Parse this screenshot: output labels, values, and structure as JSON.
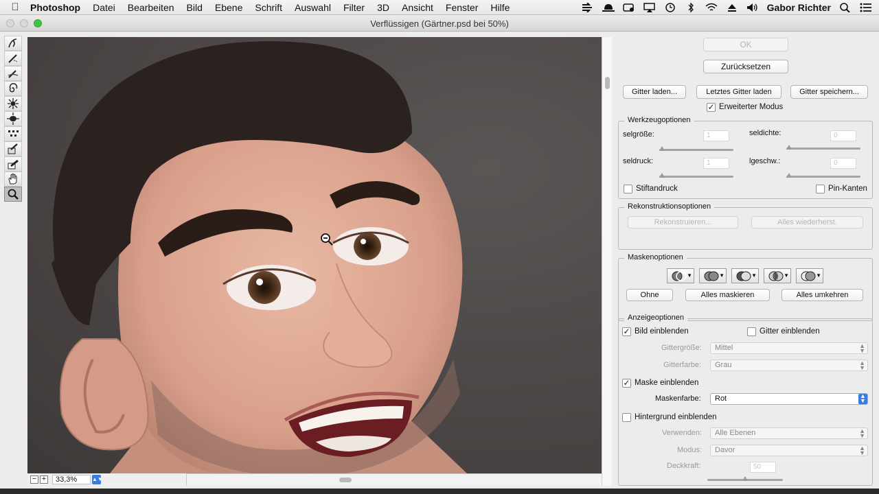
{
  "menubar": {
    "app_name": "Photoshop",
    "items": [
      "Datei",
      "Bearbeiten",
      "Bild",
      "Ebene",
      "Schrift",
      "Auswahl",
      "Filter",
      "3D",
      "Ansicht",
      "Fenster",
      "Hilfe"
    ],
    "user": "Gabor Richter"
  },
  "window": {
    "title": "Verflüssigen (Gärtner.psd bei 50%)"
  },
  "canvas": {
    "zoom": "33,3%"
  },
  "panel": {
    "ok_label": "OK",
    "reset_label": "Zurücksetzen",
    "load_mesh": "Gitter laden...",
    "load_last_mesh": "Letztes Gitter laden",
    "save_mesh": "Gitter speichern...",
    "advanced_mode": "Erweiterter Modus",
    "tool_options": {
      "title": "Werkzeugoptionen",
      "brush_size_label": "selgröße:",
      "brush_size_value": "1",
      "brush_density_label": "seldichte:",
      "brush_density_value": "0",
      "brush_pressure_label": "seldruck:",
      "brush_pressure_value": "1",
      "brush_rate_label": "lgeschw.:",
      "brush_rate_value": "0",
      "stylus_pressure": "Stiftandruck",
      "pin_edges": "Pin-Kanten"
    },
    "reconstruct_options": {
      "title": "Rekonstruktionsoptionen",
      "reconstruct": "Rekonstruieren...",
      "restore_all": "Alles wiederherst."
    },
    "mask_options": {
      "title": "Maskenoptionen",
      "none": "Ohne",
      "mask_all": "Alles maskieren",
      "invert_all": "Alles umkehren"
    },
    "view_options": {
      "title": "Anzeigeoptionen",
      "show_image": "Bild einblenden",
      "show_mesh": "Gitter einblenden",
      "mesh_size_label": "Gittergröße:",
      "mesh_size_value": "Mittel",
      "mesh_color_label": "Gitterfarbe:",
      "mesh_color_value": "Grau",
      "show_mask": "Maske einblenden",
      "mask_color_label": "Maskenfarbe:",
      "mask_color_value": "Rot",
      "show_backdrop": "Hintergrund einblenden",
      "use_label": "Verwenden:",
      "use_value": "Alle Ebenen",
      "mode_label": "Modus:",
      "mode_value": "Davor",
      "opacity_label": "Deckkraft:",
      "opacity_value": "50"
    }
  }
}
